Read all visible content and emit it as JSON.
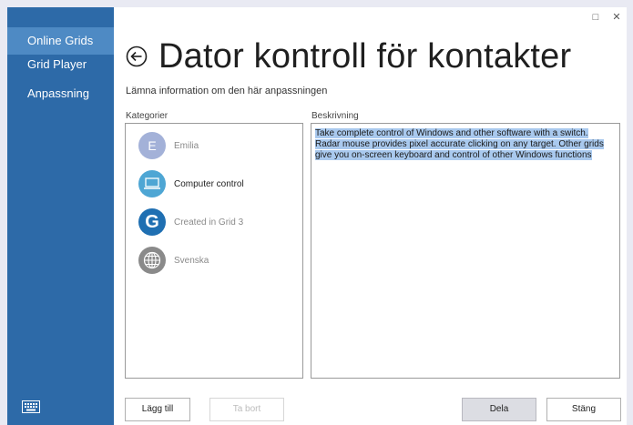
{
  "sidebar": {
    "items": [
      {
        "label": "Online Grids"
      },
      {
        "label": "Grid Player"
      },
      {
        "label": "Anpassning"
      }
    ],
    "keyboard_icon": "keyboard-icon"
  },
  "window": {
    "minimize_icon": "□",
    "close_icon": "✕"
  },
  "header": {
    "title": "Dator kontroll för kontakter",
    "subtitle": "Lämna information om den här anpassningen"
  },
  "categories": {
    "label": "Kategorier",
    "items": [
      {
        "label": "Emilia",
        "icon": "E",
        "icon_color": "#a3b1d8"
      },
      {
        "label": "Computer control",
        "icon": "monitor-icon",
        "icon_color": "#4ea6d4"
      },
      {
        "label": "Created in Grid 3",
        "icon": "G",
        "icon_color": "#1f6fb2"
      },
      {
        "label": "Svenska",
        "icon": "globe-icon",
        "icon_color": "#8a8a8a"
      }
    ]
  },
  "description": {
    "label": "Beskrivning",
    "text": "Take complete control of Windows and other software with a switch. Radar mouse provides pixel accurate clicking on any target. Other grids give you on-screen keyboard and control of other Windows functions"
  },
  "buttons": {
    "add": "Lägg till",
    "remove": "Ta bort",
    "share": "Dela",
    "close": "Stäng"
  },
  "colors": {
    "sidebar": "#2d6aa8",
    "active_item": "#4e8ac4",
    "selection": "#a9c9ee"
  }
}
